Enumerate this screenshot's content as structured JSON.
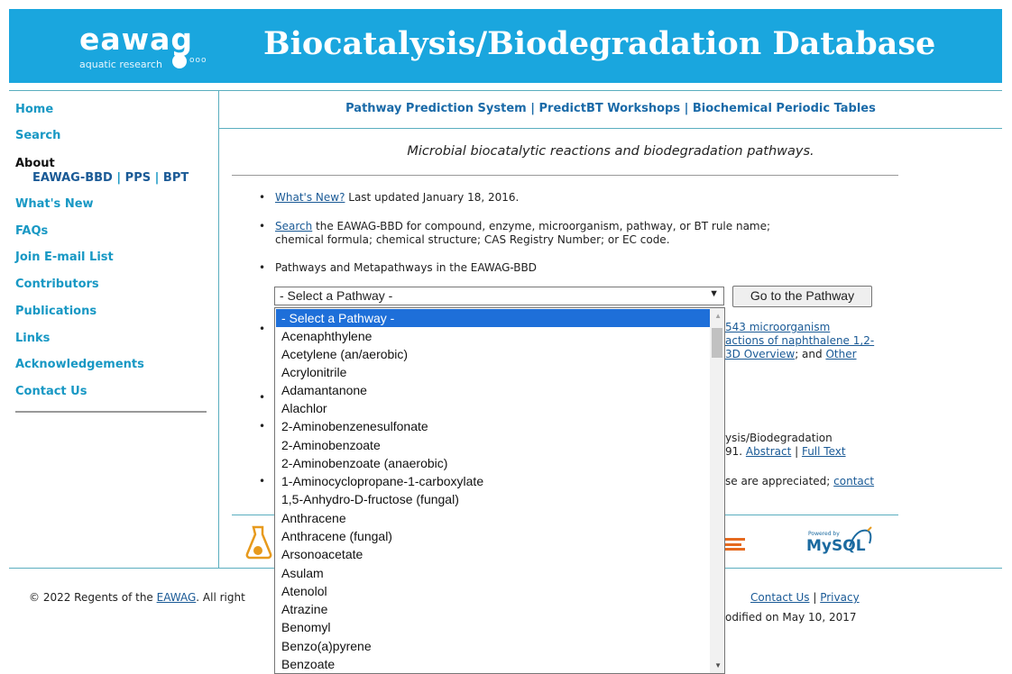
{
  "header": {
    "logo_word": "eawag",
    "logo_sub": "aquatic research",
    "logo_circles": "ooo",
    "site_title": "Biocatalysis/Biodegradation Database",
    "bg_color": "#1aa6de"
  },
  "sidebar": {
    "home": "Home",
    "search": "Search",
    "about": "About",
    "about_links": [
      "EAWAG-BBD",
      "PPS",
      "BPT"
    ],
    "about_sep": "|",
    "whats_new": "What's New",
    "faqs": "FAQs",
    "join": "Join E-mail List",
    "contributors": "Contributors",
    "publications": "Publications",
    "links": "Links",
    "acknowledgements": "Acknowledgements",
    "contact": "Contact Us"
  },
  "top_links": {
    "pps": "Pathway Prediction System",
    "workshops": "PredictBT Workshops",
    "periodic": "Biochemical Periodic Tables",
    "sep": "|"
  },
  "tagline": "Microbial biocatalytic reactions and biodegradation pathways.",
  "bullets": {
    "whats_new_link": "What's New?",
    "whats_new_text": " Last updated January 18, 2016.",
    "search_link": "Search",
    "search_text_1": " the EAWAG-BBD for compound, enzyme, microorganism, pathway, or BT rule name;",
    "search_text_2": "chemical formula; chemical structure; CAS Registry Number; or EC code.",
    "pathways_text": "Pathways and Metapathways in the EAWAG-BBD",
    "partial_1a": "543 microorganism",
    "partial_1b": "actions of naphthalene 1,2-",
    "partial_1c": "3D Overview",
    "partial_1d": "; and ",
    "partial_1e": "Other",
    "partial_2a": "ysis/Biodegradation",
    "partial_2b": "91. ",
    "partial_2c": "Abstract",
    "partial_2d": " | ",
    "partial_2e": "Full Text",
    "partial_3a": "se are appreciated; ",
    "partial_3b": "contact"
  },
  "select": {
    "value": "- Select a Pathway -",
    "button": "Go to the Pathway",
    "options": [
      "- Select a Pathway -",
      "Acenaphthylene",
      "Acetylene (an/aerobic)",
      "Acrylonitrile",
      "Adamantanone",
      "Alachlor",
      "2-Aminobenzenesulfonate",
      "2-Aminobenzoate",
      "2-Aminobenzoate (anaerobic)",
      "1-Aminocyclopropane-1-carboxylate",
      "1,5-Anhydro-D-fructose (fungal)",
      "Anthracene",
      "Anthracene (fungal)",
      "Arsonoacetate",
      "Asulam",
      "Atenolol",
      "Atrazine",
      "Benomyl",
      "Benzo(a)pyrene",
      "Benzoate"
    ]
  },
  "footer": {
    "copyright_pre": "© 2022 Regents of the ",
    "eawag_link": "EAWAG",
    "copyright_post": ". All right",
    "contact": "Contact Us",
    "sep": " | ",
    "privacy": "Privacy",
    "modified": "odified on May 10, 2017"
  },
  "logos": {
    "mysql_small": "Powered by",
    "mysql": "MySQL"
  },
  "colors": {
    "nav": "#1898c4",
    "link": "#1a5a96",
    "selected_option": "#1e6fd9",
    "rule": "#5aaebf"
  }
}
